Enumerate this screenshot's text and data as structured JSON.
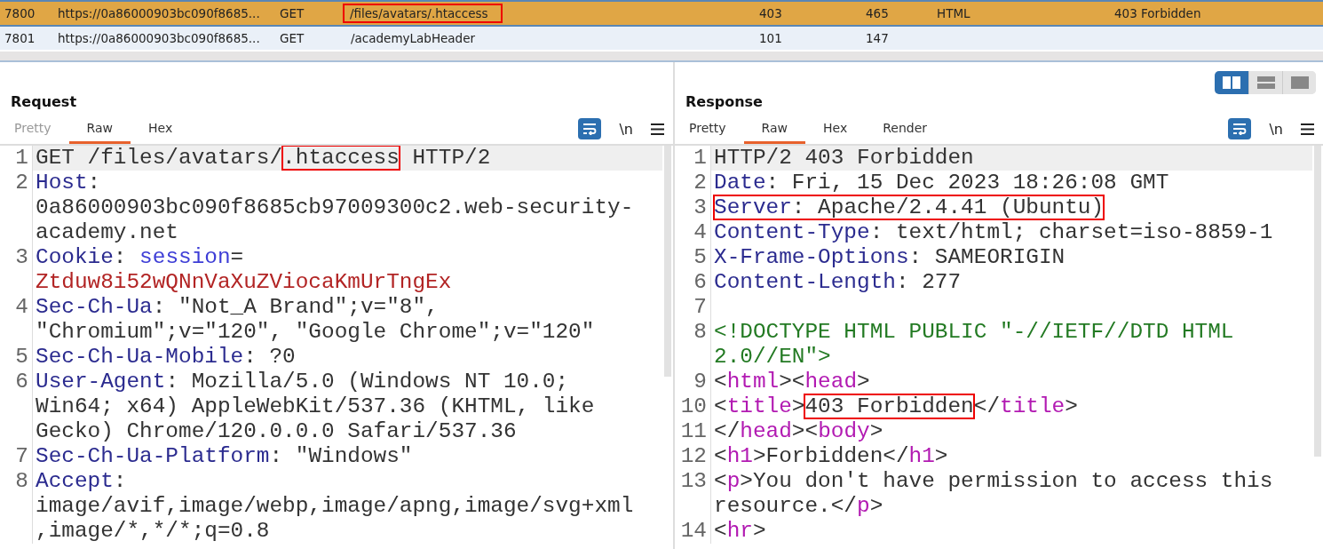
{
  "history_table": {
    "rows": [
      {
        "selected": true,
        "cells": [
          {
            "text": "7800",
            "boxed": false
          },
          {
            "text": "https://0a86000903bc090f8685...",
            "boxed": false
          },
          {
            "text": "GET",
            "boxed": false
          },
          {
            "text": "/files/avatars/.htaccess",
            "boxed": true
          },
          {
            "text": "403",
            "boxed": false
          },
          {
            "text": "465",
            "boxed": false
          },
          {
            "text": "HTML",
            "boxed": false
          },
          {
            "text": "403 Forbidden",
            "boxed": false
          }
        ]
      },
      {
        "selected": false,
        "cells": [
          {
            "text": "7801",
            "boxed": false
          },
          {
            "text": "https://0a86000903bc090f8685...",
            "boxed": false
          },
          {
            "text": "GET",
            "boxed": false
          },
          {
            "text": "/academyLabHeader",
            "boxed": false
          },
          {
            "text": "101",
            "boxed": false
          },
          {
            "text": "147",
            "boxed": false
          }
        ]
      }
    ]
  },
  "layout_toggle": [
    {
      "kind": "side",
      "selected": true
    },
    {
      "kind": "stacked",
      "selected": false
    },
    {
      "kind": "single",
      "selected": false
    }
  ],
  "panels": [
    {
      "title": "Request",
      "tabs": [
        {
          "label": "Pretty",
          "selected": false,
          "disabled": true
        },
        {
          "label": "Raw",
          "selected": true,
          "disabled": false
        },
        {
          "label": "Hex",
          "selected": false,
          "disabled": false
        }
      ],
      "toolbar": {
        "wrap_on": true,
        "newline_label": "\\n"
      },
      "lines": [
        {
          "number": "1",
          "current": true,
          "visual_lines": [
            {
              "segments": [
                {
                  "kind": "text",
                  "text": "GET /files/avatars/"
                },
                {
                  "kind": "text",
                  "text": ".htaccess",
                  "boxed": true
                },
                {
                  "kind": "text",
                  "text": " HTTP/2"
                }
              ]
            }
          ]
        },
        {
          "number": "2",
          "current": false,
          "visual_lines": [
            {
              "segments": [
                {
                  "kind": "name",
                  "text": "Host"
                },
                {
                  "kind": "text",
                  "text": ":"
                }
              ]
            },
            {
              "segments": [
                {
                  "kind": "text",
                  "text": "0a86000903bc090f8685cb97009300c2.web-security-"
                }
              ]
            },
            {
              "segments": [
                {
                  "kind": "text",
                  "text": "academy.net"
                }
              ]
            }
          ]
        },
        {
          "number": "3",
          "current": false,
          "visual_lines": [
            {
              "segments": [
                {
                  "kind": "name",
                  "text": "Cookie"
                },
                {
                  "kind": "text",
                  "text": ": "
                },
                {
                  "kind": "param",
                  "text": "session"
                },
                {
                  "kind": "text",
                  "text": "="
                }
              ]
            },
            {
              "segments": [
                {
                  "kind": "secret",
                  "text": "Ztduw8i52wQNnVaXuZViocaKmUrTngEx"
                }
              ]
            }
          ]
        },
        {
          "number": "4",
          "current": false,
          "visual_lines": [
            {
              "segments": [
                {
                  "kind": "name",
                  "text": "Sec-Ch-Ua"
                },
                {
                  "kind": "text",
                  "text": ": \"Not_A Brand\";v=\"8\","
                }
              ]
            },
            {
              "segments": [
                {
                  "kind": "text",
                  "text": "\"Chromium\";v=\"120\", \"Google Chrome\";v=\"120\""
                }
              ]
            }
          ]
        },
        {
          "number": "5",
          "current": false,
          "visual_lines": [
            {
              "segments": [
                {
                  "kind": "name",
                  "text": "Sec-Ch-Ua-Mobile"
                },
                {
                  "kind": "text",
                  "text": ": ?0"
                }
              ]
            }
          ]
        },
        {
          "number": "6",
          "current": false,
          "visual_lines": [
            {
              "segments": [
                {
                  "kind": "name",
                  "text": "User-Agent"
                },
                {
                  "kind": "text",
                  "text": ": Mozilla/5.0 (Windows NT 10.0;"
                }
              ]
            },
            {
              "segments": [
                {
                  "kind": "text",
                  "text": "Win64; x64) AppleWebKit/537.36 (KHTML, like"
                }
              ]
            },
            {
              "segments": [
                {
                  "kind": "text",
                  "text": "Gecko) Chrome/120.0.0.0 Safari/537.36"
                }
              ]
            }
          ]
        },
        {
          "number": "7",
          "current": false,
          "visual_lines": [
            {
              "segments": [
                {
                  "kind": "name",
                  "text": "Sec-Ch-Ua-Platform"
                },
                {
                  "kind": "text",
                  "text": ": \"Windows\""
                }
              ]
            }
          ]
        },
        {
          "number": "8",
          "current": false,
          "visual_lines": [
            {
              "segments": [
                {
                  "kind": "name",
                  "text": "Accept"
                },
                {
                  "kind": "text",
                  "text": ":"
                }
              ]
            },
            {
              "segments": [
                {
                  "kind": "text",
                  "text": "image/avif,image/webp,image/apng,image/svg+xml"
                }
              ]
            },
            {
              "segments": [
                {
                  "kind": "text",
                  "text": ",image/*,*/*;q=0.8"
                }
              ]
            }
          ]
        }
      ]
    },
    {
      "title": "Response",
      "tabs": [
        {
          "label": "Pretty",
          "selected": false,
          "disabled": false
        },
        {
          "label": "Raw",
          "selected": true,
          "disabled": false
        },
        {
          "label": "Hex",
          "selected": false,
          "disabled": false
        },
        {
          "label": "Render",
          "selected": false,
          "disabled": false
        }
      ],
      "toolbar": {
        "wrap_on": true,
        "newline_label": "\\n"
      },
      "lines": [
        {
          "number": "1",
          "current": true,
          "visual_lines": [
            {
              "segments": [
                {
                  "kind": "text",
                  "text": "HTTP/2 403 Forbidden"
                }
              ]
            }
          ]
        },
        {
          "number": "2",
          "current": false,
          "visual_lines": [
            {
              "segments": [
                {
                  "kind": "name",
                  "text": "Date"
                },
                {
                  "kind": "text",
                  "text": ": Fri, 15 Dec 2023 18:26:08 GMT"
                }
              ]
            }
          ]
        },
        {
          "number": "3",
          "current": false,
          "visual_lines": [
            {
              "segments": [
                {
                  "kind": "name",
                  "text": "Server",
                  "boxed": true
                },
                {
                  "kind": "text",
                  "text": ": Apache/2.4.41 (Ubuntu)",
                  "boxed": true
                }
              ]
            }
          ]
        },
        {
          "number": "4",
          "current": false,
          "visual_lines": [
            {
              "segments": [
                {
                  "kind": "name",
                  "text": "Content-Type"
                },
                {
                  "kind": "text",
                  "text": ": text/html; charset=iso-8859-1"
                }
              ]
            }
          ]
        },
        {
          "number": "5",
          "current": false,
          "visual_lines": [
            {
              "segments": [
                {
                  "kind": "name",
                  "text": "X-Frame-Options"
                },
                {
                  "kind": "text",
                  "text": ": SAMEORIGIN"
                }
              ]
            }
          ]
        },
        {
          "number": "6",
          "current": false,
          "visual_lines": [
            {
              "segments": [
                {
                  "kind": "name",
                  "text": "Content-Length"
                },
                {
                  "kind": "text",
                  "text": ": 277"
                }
              ]
            }
          ]
        },
        {
          "number": "7",
          "current": false
        },
        {
          "number": "8",
          "current": false,
          "visual_lines": [
            {
              "segments": [
                {
                  "kind": "doctype",
                  "text": "<!DOCTYPE HTML PUBLIC \"-//IETF//DTD HTML"
                }
              ]
            },
            {
              "segments": [
                {
                  "kind": "doctype",
                  "text": "2.0//EN\">"
                }
              ]
            }
          ]
        },
        {
          "number": "9",
          "current": false,
          "visual_lines": [
            {
              "segments": [
                {
                  "kind": "text",
                  "text": "<"
                },
                {
                  "kind": "tag",
                  "text": "html"
                },
                {
                  "kind": "text",
                  "text": "><"
                },
                {
                  "kind": "tag",
                  "text": "head"
                },
                {
                  "kind": "text",
                  "text": ">"
                }
              ]
            }
          ]
        },
        {
          "number": "10",
          "current": false,
          "visual_lines": [
            {
              "segments": [
                {
                  "kind": "text",
                  "text": "<"
                },
                {
                  "kind": "tag",
                  "text": "title"
                },
                {
                  "kind": "text",
                  "text": ">"
                },
                {
                  "kind": "text",
                  "text": "403 Forbidden",
                  "boxed": true
                },
                {
                  "kind": "text",
                  "text": "</"
                },
                {
                  "kind": "tag",
                  "text": "title"
                },
                {
                  "kind": "text",
                  "text": ">"
                }
              ]
            }
          ]
        },
        {
          "number": "11",
          "current": false,
          "visual_lines": [
            {
              "segments": [
                {
                  "kind": "text",
                  "text": "</"
                },
                {
                  "kind": "tag",
                  "text": "head"
                },
                {
                  "kind": "text",
                  "text": "><"
                },
                {
                  "kind": "tag",
                  "text": "body"
                },
                {
                  "kind": "text",
                  "text": ">"
                }
              ]
            }
          ]
        },
        {
          "number": "12",
          "current": false,
          "visual_lines": [
            {
              "segments": [
                {
                  "kind": "text",
                  "text": "<"
                },
                {
                  "kind": "tag",
                  "text": "h1"
                },
                {
                  "kind": "text",
                  "text": ">Forbidden</"
                },
                {
                  "kind": "tag",
                  "text": "h1"
                },
                {
                  "kind": "text",
                  "text": ">"
                }
              ]
            }
          ]
        },
        {
          "number": "13",
          "current": false,
          "visual_lines": [
            {
              "segments": [
                {
                  "kind": "text",
                  "text": "<"
                },
                {
                  "kind": "tag",
                  "text": "p"
                },
                {
                  "kind": "text",
                  "text": ">You don't have permission to access this"
                }
              ]
            },
            {
              "segments": [
                {
                  "kind": "text",
                  "text": "resource.</"
                },
                {
                  "kind": "tag",
                  "text": "p"
                },
                {
                  "kind": "text",
                  "text": ">"
                }
              ]
            }
          ]
        },
        {
          "number": "14",
          "current": false,
          "visual_lines": [
            {
              "segments": [
                {
                  "kind": "text",
                  "text": "<"
                },
                {
                  "kind": "tag",
                  "text": "hr"
                },
                {
                  "kind": "text",
                  "text": ">"
                }
              ]
            }
          ]
        }
      ]
    }
  ]
}
